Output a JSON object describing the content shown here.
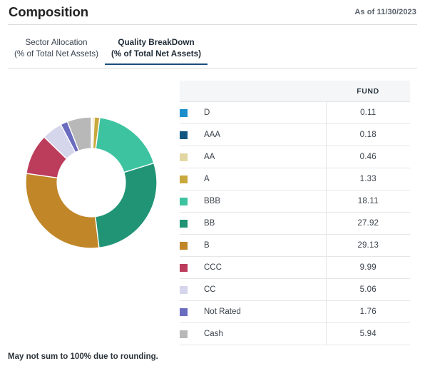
{
  "header": {
    "title": "Composition",
    "as_of": "As of 11/30/2023"
  },
  "tabs": [
    {
      "line1": "Sector Allocation",
      "line2": "(% of Total Net Assets)",
      "active": false,
      "name": "tab-sector-allocation"
    },
    {
      "line1": "Quality BreakDown",
      "line2": "(% of Total Net Assets)",
      "active": true,
      "name": "tab-quality-breakdown"
    }
  ],
  "table": {
    "columns": [
      "",
      "FUND"
    ],
    "rows": [
      {
        "label": "D",
        "value": "0.11",
        "color": "#1B8FCB"
      },
      {
        "label": "AAA",
        "value": "0.18",
        "color": "#11577F"
      },
      {
        "label": "AA",
        "value": "0.46",
        "color": "#E2D7A3"
      },
      {
        "label": "A",
        "value": "1.33",
        "color": "#C9A93E"
      },
      {
        "label": "BBB",
        "value": "18.11",
        "color": "#3DC3A0"
      },
      {
        "label": "BB",
        "value": "27.92",
        "color": "#219476"
      },
      {
        "label": "B",
        "value": "29.13",
        "color": "#C08628"
      },
      {
        "label": "CCC",
        "value": "9.99",
        "color": "#BC3C5C"
      },
      {
        "label": "CC",
        "value": "5.06",
        "color": "#D5D6EC"
      },
      {
        "label": "Not Rated",
        "value": "1.76",
        "color": "#6A6CC0"
      },
      {
        "label": "Cash",
        "value": "5.94",
        "color": "#B8B8B8"
      }
    ]
  },
  "footnote": "May not sum to 100% due to rounding.",
  "chart_data": {
    "type": "pie",
    "title": "Quality BreakDown (% of Total Net Assets)",
    "donut": true,
    "inner_radius_ratio": 0.52,
    "start_angle_deg": 0,
    "direction": "clockwise",
    "labels": [
      "D",
      "AAA",
      "AA",
      "A",
      "BBB",
      "BB",
      "B",
      "CCC",
      "CC",
      "Not Rated",
      "Cash"
    ],
    "values": [
      0.11,
      0.18,
      0.46,
      1.33,
      18.11,
      27.92,
      29.13,
      9.99,
      5.06,
      1.76,
      5.94
    ],
    "colors": [
      "#1B8FCB",
      "#11577F",
      "#E2D7A3",
      "#C9A93E",
      "#3DC3A0",
      "#219476",
      "#C08628",
      "#BC3C5C",
      "#D5D6EC",
      "#6A6CC0",
      "#B8B8B8"
    ],
    "unit": "% of Total Net Assets",
    "total": 99.99,
    "legend_position": "right-table"
  }
}
